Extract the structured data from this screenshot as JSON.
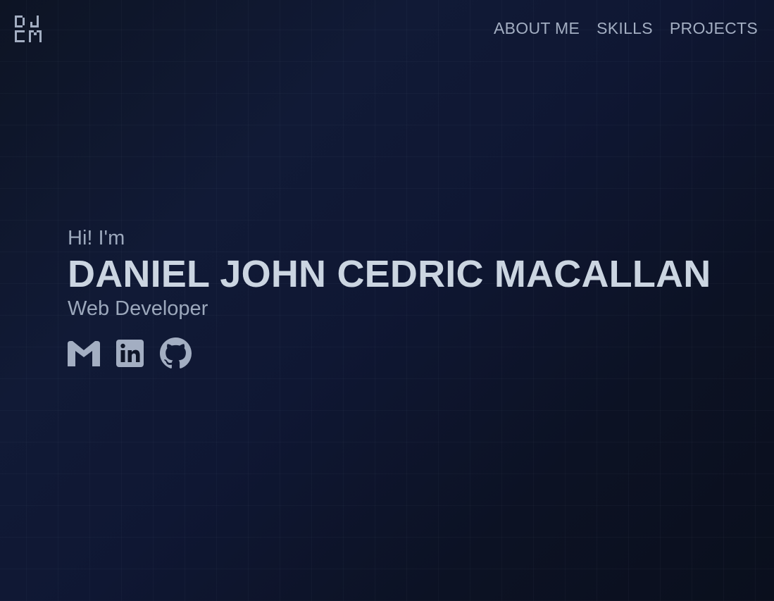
{
  "brand": {
    "logo_text": "DJCM",
    "color": "#a3aec2"
  },
  "nav": {
    "items": [
      {
        "label": "ABOUT ME"
      },
      {
        "label": "SKILLS"
      },
      {
        "label": "PROJECTS"
      }
    ]
  },
  "hero": {
    "greeting": "Hi! I'm",
    "name": "DANIEL JOHN CEDRIC MACALLAN",
    "role": "Web Developer"
  },
  "socials": [
    {
      "icon": "gmail-icon"
    },
    {
      "icon": "linkedin-icon"
    },
    {
      "icon": "github-icon"
    }
  ],
  "colors": {
    "background": "#0f1628",
    "text_primary": "#cbd5e1",
    "text_secondary": "#9ca8bc"
  }
}
